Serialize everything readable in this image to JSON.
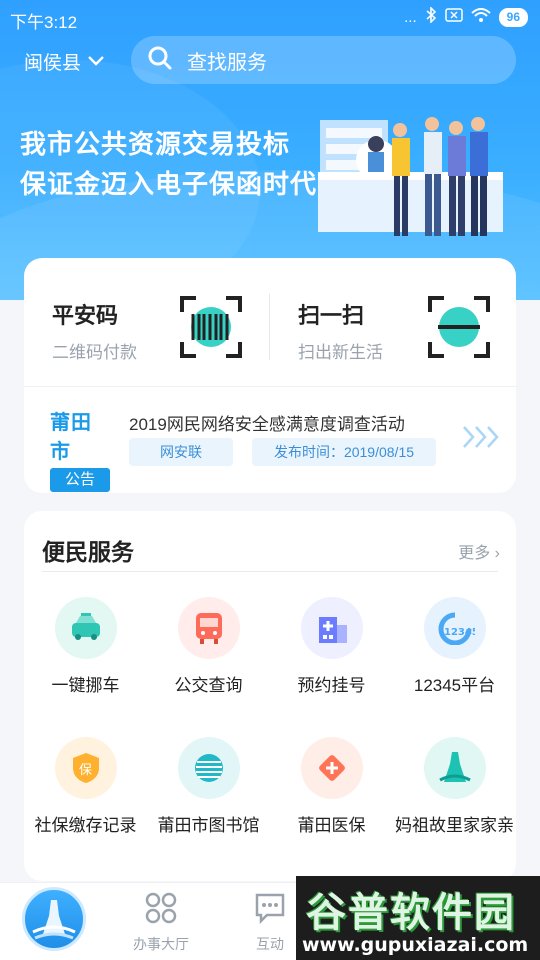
{
  "status": {
    "time": "下午3:12",
    "signal": "...",
    "battery": "96"
  },
  "topbar": {
    "city": "闽侯县",
    "search_placeholder": "查找服务"
  },
  "banner": {
    "line1": "我市公共资源交易投标",
    "line2": "保证金迈入电子保函时代"
  },
  "quick_actions": [
    {
      "title": "平安码",
      "subtitle": "二维码付款",
      "icon": "barcode-icon"
    },
    {
      "title": "扫一扫",
      "subtitle": "扫出新生活",
      "icon": "scan-icon"
    }
  ],
  "notice": {
    "brand": "莆田市",
    "tag": "公告",
    "title": "2019网民网络安全感满意度调查活动",
    "source": "网安联",
    "date": "发布时间：2019/08/15"
  },
  "services": {
    "title": "便民服务",
    "more": "更多",
    "items": [
      {
        "label": "一键挪车",
        "icon": "car-icon",
        "color": "#2fc7b3"
      },
      {
        "label": "公交查询",
        "icon": "bus-icon",
        "color": "#ff6b5a"
      },
      {
        "label": "预约挂号",
        "icon": "hospital-icon",
        "color": "#6b7cff"
      },
      {
        "label": "12345平台",
        "icon": "hotline-icon",
        "color": "#4aa8f5"
      },
      {
        "label": "社保缴存记录",
        "icon": "shield-icon",
        "color": "#ffb02e"
      },
      {
        "label": "莆田市图书馆",
        "icon": "library-icon",
        "color": "#21b8c7"
      },
      {
        "label": "莆田医保",
        "icon": "medical-icon",
        "color": "#ff7357"
      },
      {
        "label": "妈祖故里家家亲",
        "icon": "statue-icon",
        "color": "#1cc3b3"
      }
    ]
  },
  "tabbar": {
    "hall": "办事大厅",
    "interact": "互动"
  },
  "watermark": {
    "name": "谷普软件园",
    "url": "www.gupuxiazai.com"
  },
  "colors": {
    "primary": "#2fa0ff",
    "accent": "#1a9ae8"
  }
}
